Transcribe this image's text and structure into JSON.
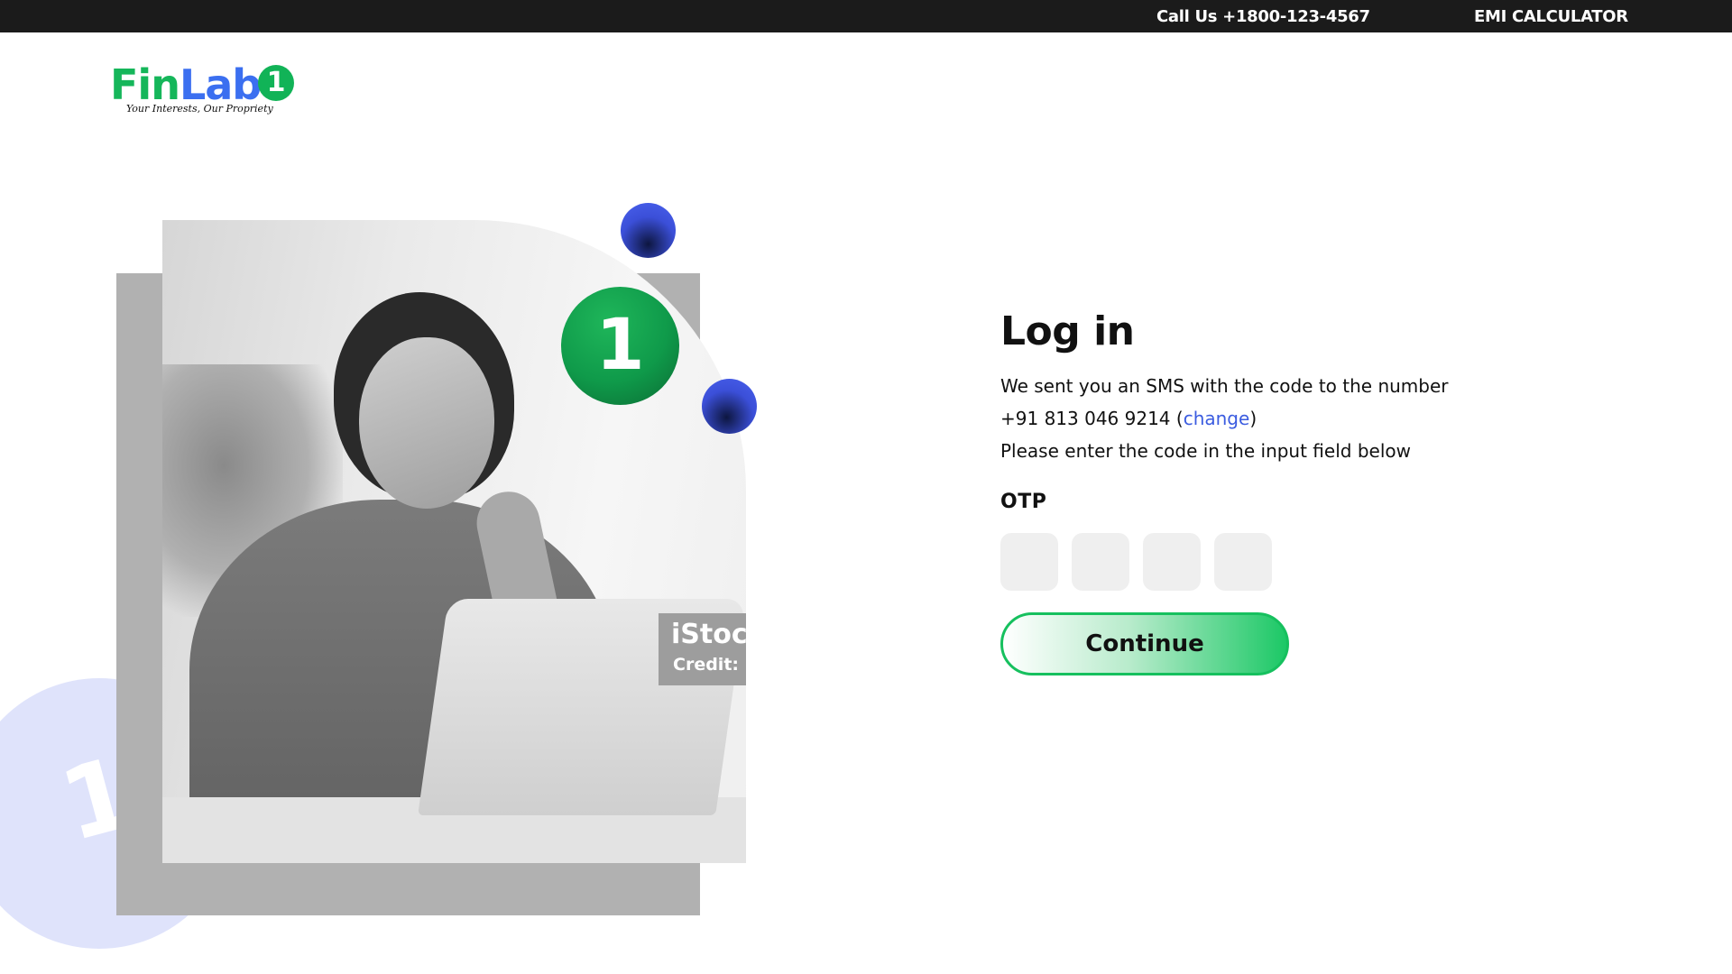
{
  "topbar": {
    "phone": "Call Us +1800-123-4567",
    "emi_link": "EMI CALCULATOR"
  },
  "brand": {
    "fin": "Fin",
    "lab": "Lab",
    "badge_digit": "1",
    "tagline": "Your Interests, Our Propriety",
    "colors": {
      "green": "#15b65a",
      "blue": "#3b6ff0"
    }
  },
  "hero": {
    "badge_digit": "1",
    "watermark_title": "iStock",
    "watermark_credit": "Credit:"
  },
  "login": {
    "title": "Log in",
    "sms_line": "We sent you an SMS with the code to the number",
    "phone_number": "+91 813 046 9214",
    "paren_open": " (",
    "change_link": "change",
    "paren_close": ")",
    "instruction": "Please enter the code in the input field below",
    "otp_label": "OTP",
    "otp_values": [
      "",
      "",
      "",
      ""
    ],
    "continue_label": "Continue",
    "accent": "#16c05e"
  }
}
